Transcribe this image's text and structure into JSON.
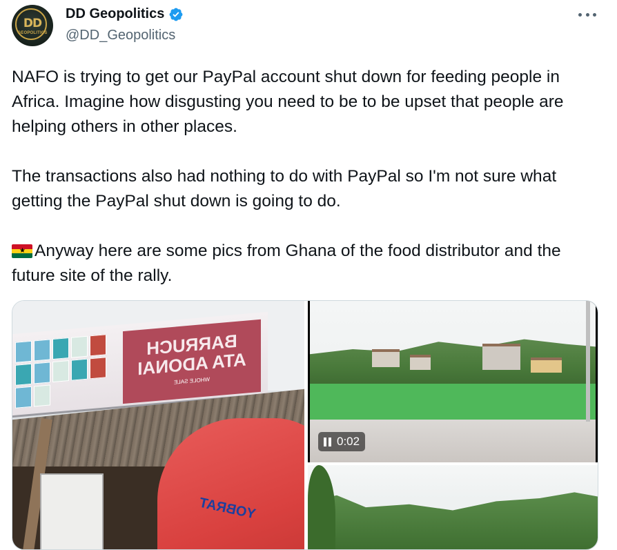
{
  "author": {
    "display_name": "DD Geopolitics",
    "handle": "@DD_Geopolitics",
    "avatar_text": "DD",
    "avatar_subtext": "GEOPOLITICS",
    "verified": true
  },
  "tweet": {
    "paragraph_1": "NAFO is trying to get our PayPal account shut down for feeding people in Africa. Imagine how disgusting you need to be to be upset that people are helping others in other places.",
    "paragraph_2": "The transactions also had nothing to do with PayPal so I'm not sure what getting the PayPal shut down is going to do.",
    "paragraph_3": "Anyway here are some pics from Ghana of the food distributor and the future site of the rally."
  },
  "media": {
    "photo_left": {
      "sign_text": "BARRUCH\nATA ADONAI",
      "sign_small": "WHOLE SALE",
      "shirt_text": "YOBRAT"
    },
    "video": {
      "timestamp": "0:02",
      "state": "paused"
    }
  },
  "colors": {
    "text": "#0f1419",
    "secondary": "#536471",
    "verified_blue": "#1d9bf0",
    "border": "#cfd9de"
  }
}
